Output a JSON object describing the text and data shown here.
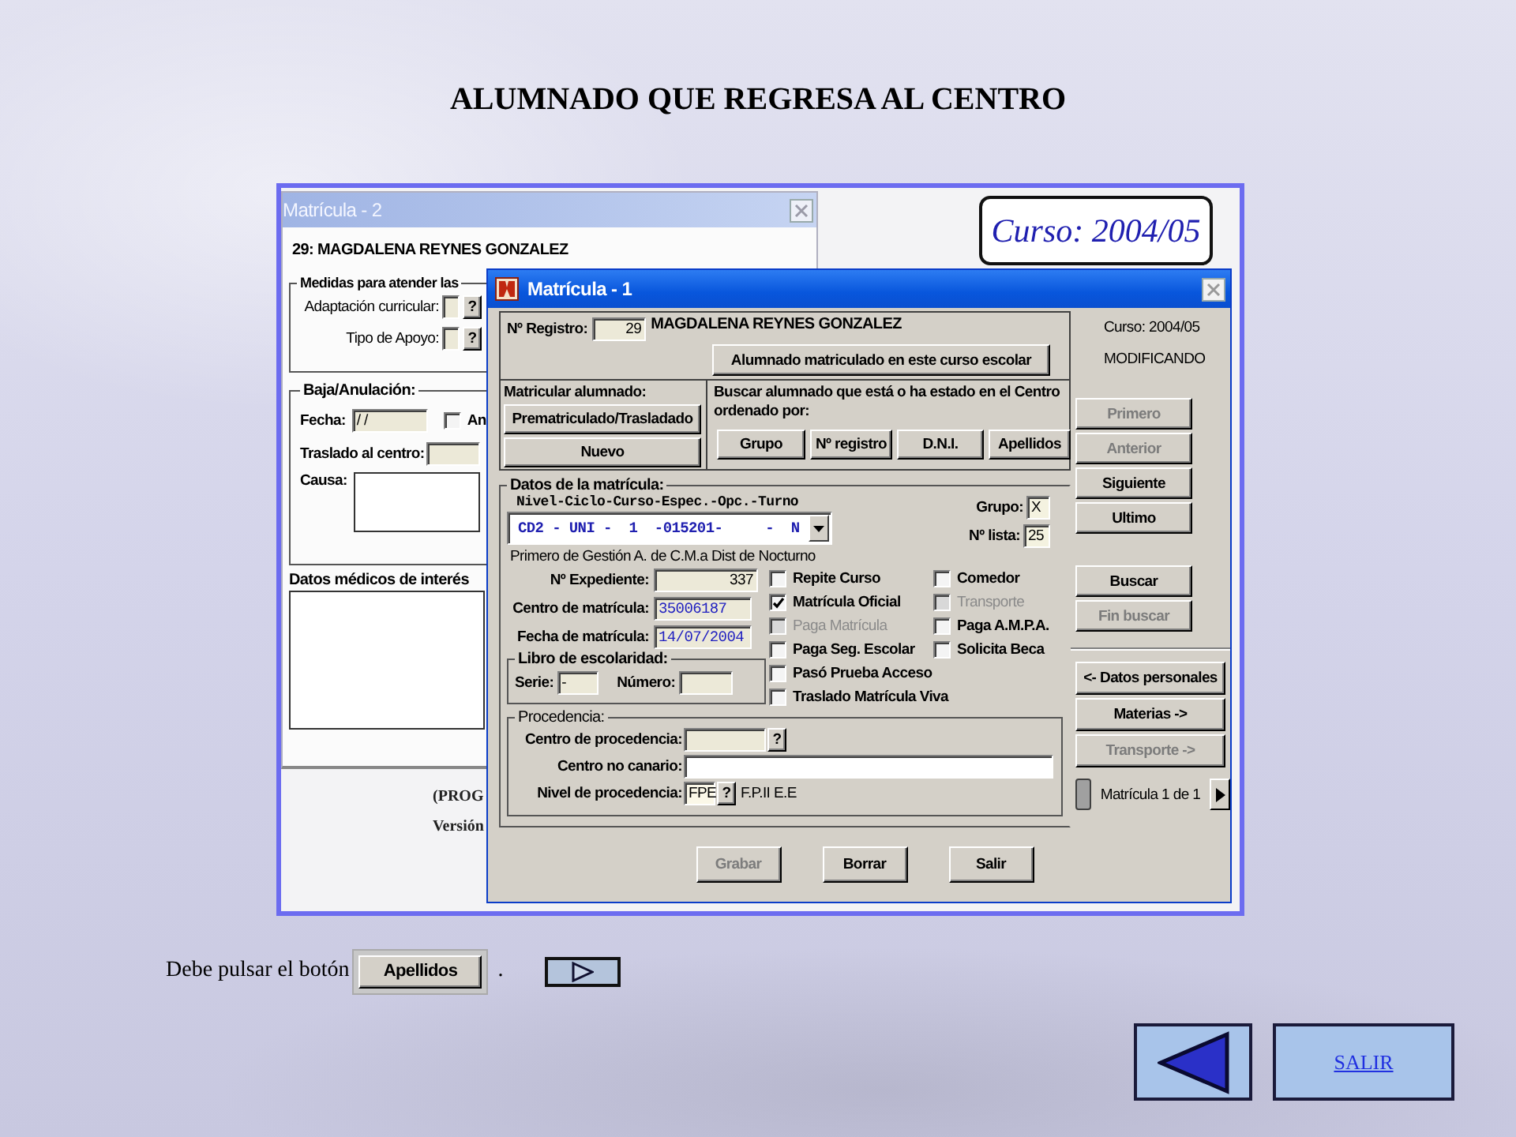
{
  "title": "ALUMNADO QUE REGRESA AL CENTRO",
  "screenshot": {
    "window_back": {
      "title": "Matrícula - 2",
      "student": "29: MAGDALENA REYNES GONZALEZ",
      "medidas": {
        "legend": "Medidas para atender las",
        "rows": [
          {
            "label": "Adaptación curricular:",
            "help": "?"
          },
          {
            "label": "Tipo de Apoyo:",
            "help": "?"
          }
        ]
      },
      "baja": {
        "legend": "Baja/Anulación:",
        "fecha_label": "Fecha:",
        "fecha_value": "/ /",
        "checkbox_label": "An",
        "checked": false,
        "traslado_label": "Traslado al centro:",
        "causa_label": "Causa:"
      },
      "medical_label": "Datos médicos de interés"
    },
    "course_badge": "Curso: 2004/05",
    "background_texts": [
      "(PROG",
      "Versión"
    ],
    "window_front": {
      "title": "Matrícula - 1",
      "registro": {
        "label": "Nº Registro:",
        "value": "29",
        "name": "MAGDALENA REYNES GONZALEZ"
      },
      "current_button": "Alumnado matriculado en este curso escolar",
      "matricular": {
        "label": "Matricular alumnado:",
        "buttons": [
          "Prematriculado/Trasladado",
          "Nuevo"
        ]
      },
      "buscar": {
        "label": "Buscar alumnado que está o ha estado en el Centro ordenado por:",
        "buttons": [
          "Grupo",
          "Nº registro",
          "D.N.I.",
          "Apellidos"
        ]
      },
      "datos": {
        "legend": "Datos de la matrícula:",
        "code_label": "Nivel-Ciclo-Curso-Espec.-Opc.-Turno",
        "code_value": "CD2 - UNI -  1  -015201-     -  N",
        "grupo": {
          "label": "Grupo:",
          "value": "X"
        },
        "lista": {
          "label": "Nº lista:",
          "value": "25"
        },
        "description": "Primero de Gestión A. de C.M.a Dist de Nocturno",
        "fields": [
          {
            "label": "Nº Expediente:",
            "value": "337",
            "kind": "number"
          },
          {
            "label": "Centro de matrícula:",
            "value": "35006187",
            "kind": "code"
          },
          {
            "label": "Fecha de matrícula:",
            "value": "14/07/2004",
            "kind": "code"
          }
        ],
        "libro": {
          "legend": "Libro de escolaridad:",
          "serie_label": "Serie:",
          "serie_value": "-",
          "numero_label": "Número:"
        },
        "checks": [
          {
            "label": "Repite Curso",
            "checked": false,
            "disabled": false,
            "wide": false
          },
          {
            "label": "Comedor",
            "checked": false,
            "disabled": false,
            "wide": false
          },
          {
            "label": "Matrícula Oficial",
            "checked": true,
            "disabled": false,
            "wide": false
          },
          {
            "label": "Transporte",
            "checked": false,
            "disabled": true,
            "wide": false
          },
          {
            "label": "Paga Matrícula",
            "checked": false,
            "disabled": true,
            "wide": false
          },
          {
            "label": "Paga A.M.P.A.",
            "checked": false,
            "disabled": false,
            "wide": false
          },
          {
            "label": "Paga Seg. Escolar",
            "checked": false,
            "disabled": false,
            "wide": false
          },
          {
            "label": "Solicita Beca",
            "checked": false,
            "disabled": false,
            "wide": false
          },
          {
            "label": "Pasó Prueba Acceso",
            "checked": false,
            "disabled": false,
            "wide": true
          },
          {
            "label": "Traslado Matrícula Viva",
            "checked": false,
            "disabled": false,
            "wide": true
          }
        ],
        "procedencia": {
          "legend": "Procedencia:",
          "centro_label": "Centro de procedencia:",
          "help": "?",
          "no_canario_label": "Centro no canario:",
          "nivel_label": "Nivel de procedencia:",
          "nivel_value": "FPE",
          "nivel_help": "?",
          "nivel_text": "F.P.II E.E"
        }
      },
      "side": {
        "curso": "Curso: 2004/05",
        "mode": "MODIFICANDO",
        "nav_buttons": [
          {
            "label": "Primero",
            "disabled": true
          },
          {
            "label": "Anterior",
            "disabled": true
          },
          {
            "label": "Siguiente",
            "disabled": false
          },
          {
            "label": "Ultimo",
            "disabled": false
          }
        ],
        "search_buttons": [
          {
            "label": "Buscar",
            "disabled": false
          },
          {
            "label": "Fin buscar",
            "disabled": true
          }
        ],
        "section_buttons": [
          {
            "label": "<- Datos personales",
            "disabled": false
          },
          {
            "label": "Materias ->",
            "disabled": false
          },
          {
            "label": "Transporte ->",
            "disabled": true
          }
        ],
        "counter": "Matrícula 1 de 1"
      },
      "actions": [
        {
          "label": "Grabar",
          "disabled": true
        },
        {
          "label": "Borrar",
          "disabled": false
        },
        {
          "label": "Salir",
          "disabled": false
        }
      ]
    }
  },
  "instruction": {
    "text": "Debe pulsar el botón",
    "button": "Apellidos",
    "after": "."
  },
  "navigation": {
    "exit": "SALIR"
  }
}
